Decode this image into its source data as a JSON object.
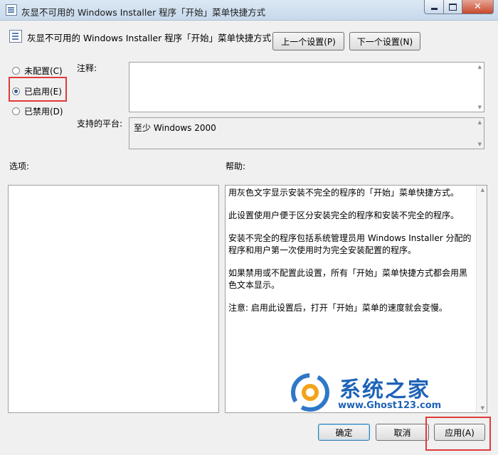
{
  "window": {
    "title": "灰显不可用的 Windows Installer 程序「开始」菜单快捷方式"
  },
  "header": {
    "setting_title": "灰显不可用的 Windows Installer 程序「开始」菜单快捷方式"
  },
  "nav": {
    "prev_label": "上一个设置(P)",
    "next_label": "下一个设置(N)"
  },
  "options": {
    "not_configured": "未配置(C)",
    "enabled": "已启用(E)",
    "disabled": "已禁用(D)",
    "selected": "enabled"
  },
  "comment": {
    "label": "注释:",
    "value": ""
  },
  "platform": {
    "label": "支持的平台:",
    "value": "至少 Windows 2000"
  },
  "options_section": {
    "label": "选项:"
  },
  "help_section": {
    "label": "帮助:",
    "paragraphs": [
      "用灰色文字显示安装不完全的程序的「开始」菜单快捷方式。",
      "此设置使用户便于区分安装完全的程序和安装不完全的程序。",
      "安装不完全的程序包括系统管理员用 Windows Installer 分配的程序和用户第一次使用时为完全安装配置的程序。",
      "如果禁用或不配置此设置，所有「开始」菜单快捷方式都会用黑色文本显示。",
      "注意: 启用此设置后，打开「开始」菜单的速度就会变慢。"
    ]
  },
  "footer": {
    "ok_label": "确定",
    "cancel_label": "取消",
    "apply_label": "应用(A)"
  },
  "watermark": {
    "brand": "系统之家",
    "url": "www.Ghost123.com"
  },
  "colors": {
    "highlight": "#e03a3a",
    "watermark": "#1e63b8"
  }
}
